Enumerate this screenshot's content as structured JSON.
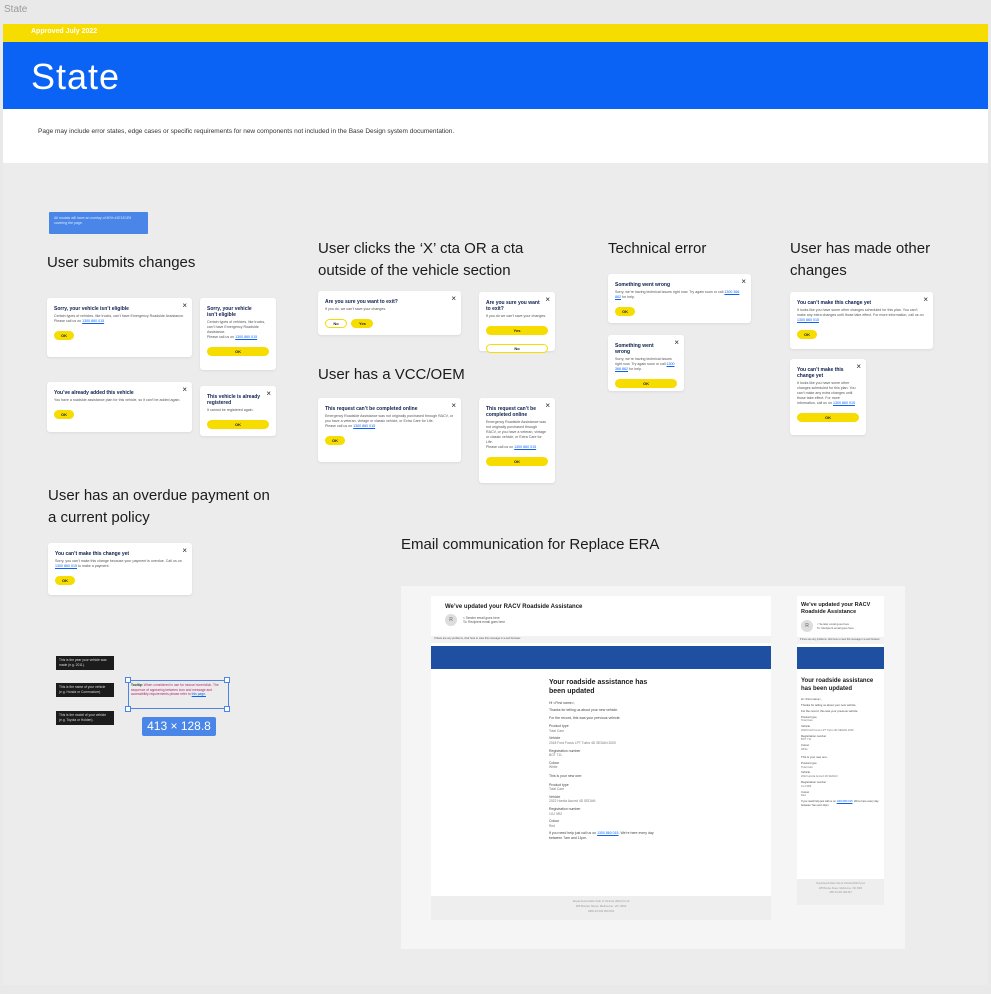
{
  "frame_label": "State",
  "approval": "Approved July 2022",
  "page_title": "State",
  "intro": "Page may include error states, edge cases or specific requirements for new components not included in the Base Design system documentation.",
  "note": "All modals will have an overlay of 80% #1E1E1E5 covering the page.",
  "sections": {
    "submit": "User submits changes",
    "exit": "User clicks the ‘X’ cta OR a cta outside of the vehicle section",
    "tech": "Technical error",
    "other": "User has made other changes",
    "vcc": "User has a VCC/OEM",
    "overdue": "User has an overdue payment on a current policy",
    "email": "Email communication for Replace ERA"
  },
  "close_icon": "×",
  "ok": "OK",
  "yes": "Yes",
  "no": "No",
  "phone": "1300 860 015",
  "modals": {
    "ineligible_title": "Sorry, your vehicle isn’t eligible",
    "ineligible_body": "Certain types of vehicles, like trucks, can’t have Emergency Roadside Assistance.",
    "ineligible_call": "Please call us on",
    "ineligible_m_title": "Sorry, your vehicle isn’t eligible",
    "ineligible_m_body": "Certain types of vehicles, like trucks, can’t have Emergency Roadside Assistance.",
    "added_title": "You’ve already added this vehicle",
    "added_body": "You have a roadside assistance plan for this vehicle, so it can’t be added again.",
    "registered_title": "This vehicle is already registered",
    "registered_body": "It cannot be registered again.",
    "exit_title": "Are you sure you want to exit?",
    "exit_body": "If you do, we can’t save your changes.",
    "exit_m_title": "Are you sure you want to exit?",
    "exit_m_body": "If you do we can’t save your changes.",
    "tech_title": "Something went wrong",
    "tech_body": "Sorry, we’re having technical issues right now. Try again soon or call",
    "tech_phone": "1300 366 862",
    "tech_tail": "for help.",
    "tech_m_title": "Something went wrong",
    "tech_m_body": "Sorry, we’re having technical issues right now. Try again soon or call",
    "change_title": "You can’t make this change yet",
    "change_body": "It looks like you have some other changes scheduled for this plan. You can’t make any extra changes until those take effect. For more information, call us on",
    "change_m_title": "You can’t make this change yet",
    "change_m_body": "It looks like you have some other changes scheduled for this plan. You can’t make any extra changes until those take effect. For more information, call us on",
    "vcc_title": "This request can’t be completed online",
    "vcc_body": "Emergency Roadside Assistance was not originally purchased through RACV, or you have a veteran, vintage or classic vehicle, or Extra Care for Life.",
    "vcc_call": "Please call us on",
    "vcc_m_title": "This request can’t be completed online",
    "vcc_m_body": "Emergency Roadside Assistance was not originally purchased through RACV, or you have a veteran, vintage or classic vehicle, or Extra Care for Life.",
    "overdue_title": "You can’t make this change yet",
    "overdue_body": "Sorry, you can’t make this change because your payment is overdue. Call us on",
    "overdue_tail": "to make a payment."
  },
  "tooltips": [
    "This is the year your vehicle was made (e.g. 2011).",
    "This is the name of your vehicle (e.g. Honda or Commodore).",
    "This is the model of your vehicle (e.g. Toyota or Holden)."
  ],
  "tooltip_spec": {
    "label": "Tooltip:",
    "text": "When considered in use for mouse hover/click. The sequence of appearing between icon and message and accessibility requirements please refer to",
    "link": "this page."
  },
  "selection_size": "413 × 128.8",
  "email": {
    "subject": "We’ve updated your RACV Roadside Assistance",
    "from": "< Sender email goes here",
    "to": "To: Recipient email goes here",
    "avatar": "R",
    "banner_note": "If there are any problems, click here to view this message in a web browser.",
    "heading": "Your roadside assistance has been updated",
    "greeting": "Hi <First name>,",
    "thanks": "Thanks for telling us about your new vehicle.",
    "prev_intro": "For the record, this was your previous vehicle:",
    "new_intro": "This is your new one:",
    "labels": [
      "Product type",
      "Vehicle",
      "Registration number",
      "Colour"
    ],
    "prev_values": [
      "Total Care",
      "2018 Ford Focus LPT Turbo 4D SEDAN 2000",
      "BOT 711",
      "White"
    ],
    "new_values": [
      "Total Care",
      "2022 Honda Accord 4D SEDAN",
      "1GJ 9RZ",
      "Red"
    ],
    "help": "If you need help just call us on",
    "help_tail": ". We’re here every day between 7am and 11pm.",
    "footer1": "Royal Automobile Club of Victoria (RACV) Ltd",
    "footer2": "485 Bourke Street, Melbourne, VIC 3000",
    "footer3": "ABN 44 004 060 833"
  }
}
